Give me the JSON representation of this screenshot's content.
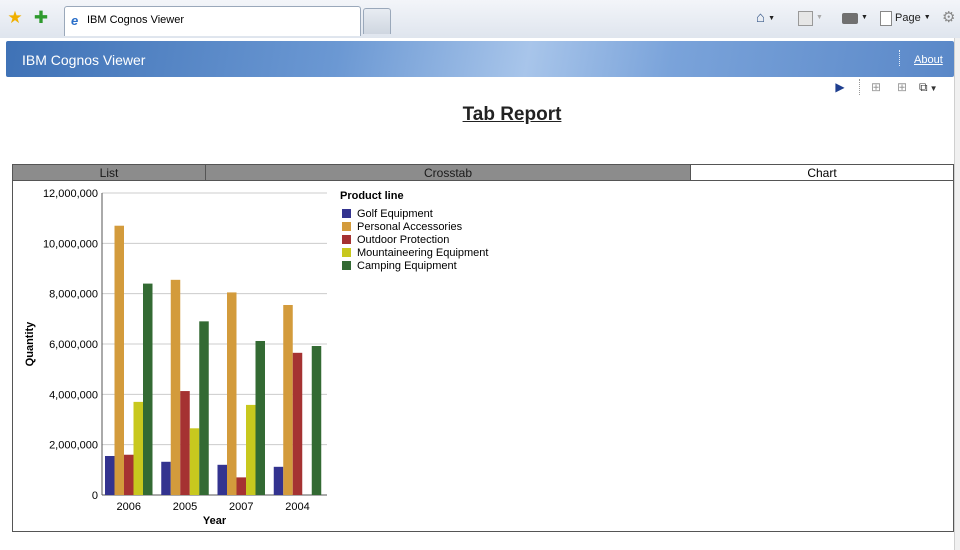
{
  "browser": {
    "tab_title": "IBM Cognos Viewer",
    "page_menu": "Page"
  },
  "viewer": {
    "title": "IBM Cognos Viewer",
    "about": "About"
  },
  "report": {
    "title": "Tab Report",
    "tabs": [
      {
        "label": "List",
        "active": false
      },
      {
        "label": "Crosstab",
        "active": false
      },
      {
        "label": "Chart",
        "active": true
      }
    ]
  },
  "chart_data": {
    "type": "bar",
    "xlabel": "Year",
    "ylabel": "Quantity",
    "ylim": [
      0,
      12000000
    ],
    "yticks": [
      "0",
      "2,000,000",
      "4,000,000",
      "6,000,000",
      "8,000,000",
      "10,000,000",
      "12,000,000"
    ],
    "grid": true,
    "legend_title": "Product line",
    "legend_position": "right",
    "categories": [
      "2006",
      "2005",
      "2007",
      "2004"
    ],
    "series": [
      {
        "name": "Golf Equipment",
        "color": "#33338f",
        "values": [
          1550000,
          1320000,
          1200000,
          1120000
        ]
      },
      {
        "name": "Personal Accessories",
        "color": "#d39b3c",
        "values": [
          10700000,
          8550000,
          8050000,
          7550000
        ]
      },
      {
        "name": "Outdoor Protection",
        "color": "#a53232",
        "values": [
          1600000,
          4130000,
          700000,
          5650000
        ]
      },
      {
        "name": "Mountaineering Equipment",
        "color": "#c8c81e",
        "values": [
          3700000,
          2650000,
          3580000,
          0
        ]
      },
      {
        "name": "Camping Equipment",
        "color": "#336a33",
        "values": [
          8400000,
          6900000,
          6120000,
          5920000
        ]
      }
    ]
  }
}
